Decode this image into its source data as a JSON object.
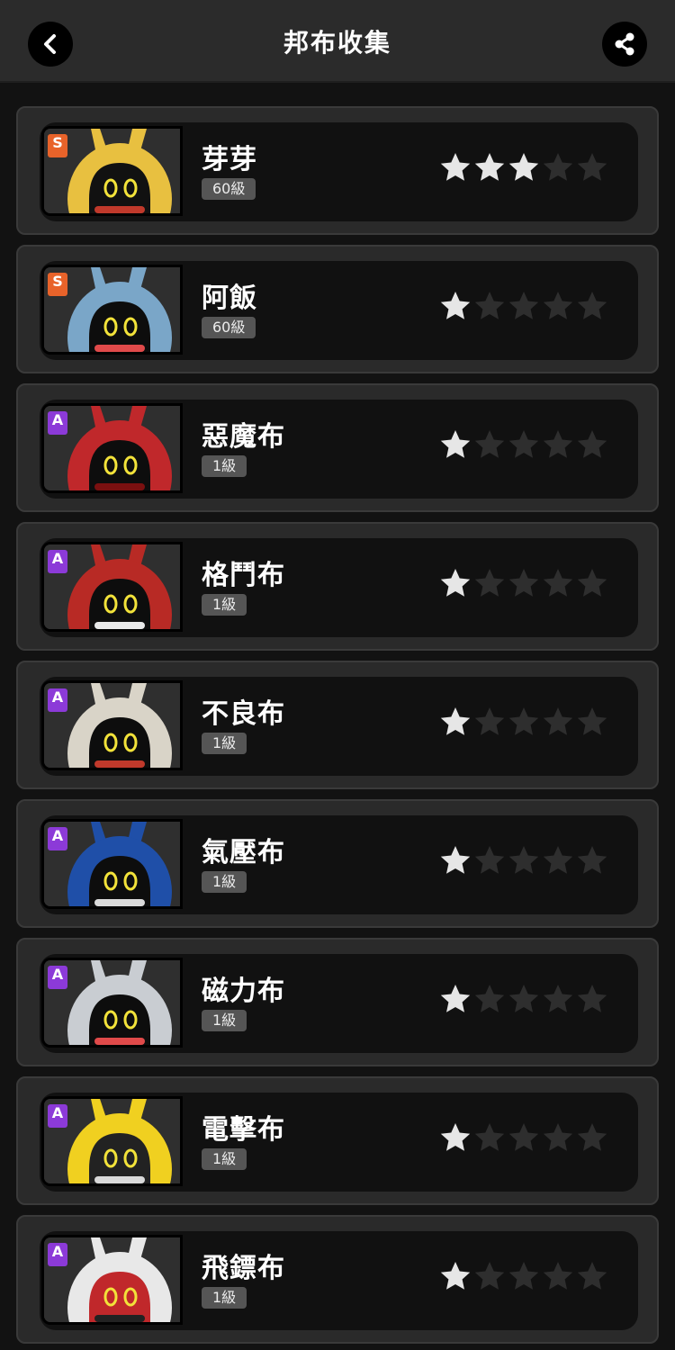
{
  "header": {
    "title": "邦布收集",
    "back_icon": "chevron-left-icon",
    "share_icon": "share-icon"
  },
  "star_colors": {
    "filled": "#e6e6e6",
    "empty": "#2e2e2e"
  },
  "rank_colors": {
    "S": "#e8632a",
    "A": "#8c3ad8"
  },
  "bangboos": [
    {
      "name": "芽芽",
      "rank": "S",
      "level": "60級",
      "stars": 3,
      "palette": [
        "#e8c040",
        "#111111",
        "#c0392b"
      ]
    },
    {
      "name": "阿飯",
      "rank": "S",
      "level": "60級",
      "stars": 1,
      "palette": [
        "#7aa6c8",
        "#0d0d0d",
        "#e04a4a"
      ]
    },
    {
      "name": "惡魔布",
      "rank": "A",
      "level": "1級",
      "stars": 1,
      "palette": [
        "#c0282b",
        "#0d0d0d",
        "#7a1010"
      ]
    },
    {
      "name": "格鬥布",
      "rank": "A",
      "level": "1級",
      "stars": 1,
      "palette": [
        "#b82a25",
        "#0d0d0d",
        "#e8e8e8"
      ]
    },
    {
      "name": "不良布",
      "rank": "A",
      "level": "1級",
      "stars": 1,
      "palette": [
        "#d9d4c8",
        "#0d0d0d",
        "#c0392b"
      ]
    },
    {
      "name": "氣壓布",
      "rank": "A",
      "level": "1級",
      "stars": 1,
      "palette": [
        "#1f4fa8",
        "#0d0d0d",
        "#d9d9d9"
      ]
    },
    {
      "name": "磁力布",
      "rank": "A",
      "level": "1級",
      "stars": 1,
      "palette": [
        "#c9cdd2",
        "#0d0d0d",
        "#e04a4a"
      ]
    },
    {
      "name": "電擊布",
      "rank": "A",
      "level": "1級",
      "stars": 1,
      "palette": [
        "#f0d020",
        "#222222",
        "#d9d9d9"
      ]
    },
    {
      "name": "飛鏢布",
      "rank": "A",
      "level": "1級",
      "stars": 1,
      "palette": [
        "#e8e8e8",
        "#c0282b",
        "#222222"
      ]
    }
  ]
}
